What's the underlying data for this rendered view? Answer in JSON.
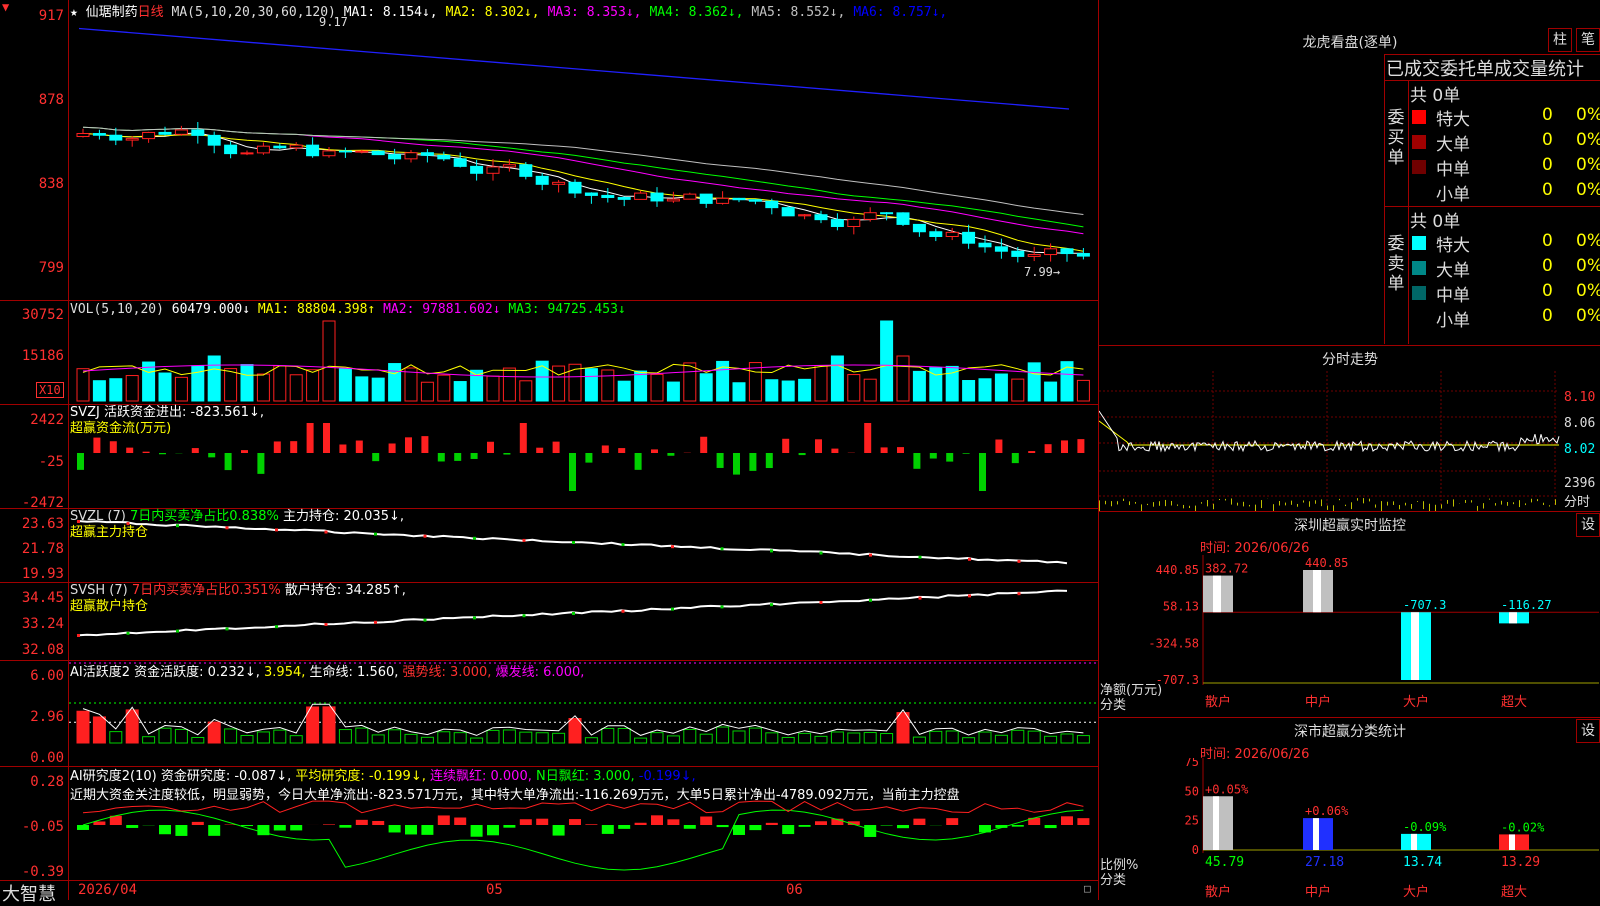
{
  "kline": {
    "title_star": "★",
    "stock_name": "仙琚制药",
    "period": "日线",
    "ma_params": "MA(5,10,20,30,60,120)",
    "ma_values": [
      {
        "label": "MA1:",
        "value": "8.154↓",
        "color": "#ffffff"
      },
      {
        "label": "MA2:",
        "value": "8.302↓",
        "color": "#ffff00"
      },
      {
        "label": "MA3:",
        "value": "8.353↓",
        "color": "#ff00ff"
      },
      {
        "label": "MA4:",
        "value": "8.362↓",
        "color": "#00ff00"
      },
      {
        "label": "MA5:",
        "value": "8.552↓",
        "color": "#c0c0c0"
      },
      {
        "label": "MA6:",
        "value": "8.757↓",
        "color": "#0000ff"
      }
    ],
    "y_labels": [
      "917",
      "878",
      "838",
      "799"
    ],
    "high_marker": "9.17",
    "low_marker": "7.99",
    "x_labels": [
      "2026/04",
      "05",
      "06"
    ],
    "colors": {
      "up": "#ff2020",
      "down": "#00ffff"
    }
  },
  "vol": {
    "params": "VOL(5,10,20)",
    "value": "60479.000↓",
    "ma1": "MA1: 88804.398↑",
    "ma2": "MA2: 97881.602↓",
    "ma3": "MA3: 94725.453↓",
    "y_labels": [
      "30752",
      "15186"
    ],
    "unit_badge": "X10"
  },
  "svzj": {
    "line1": "SVZJ  活跃资金进出: -823.561↓,",
    "line2": "超赢资金流(万元)",
    "y_labels": [
      "2422",
      "-25",
      "-2472"
    ]
  },
  "svzl": {
    "params": "SVZL (7)",
    "ratio": "7日内买卖净占比0.838%",
    "hold": "主力持仓: 20.035↓,",
    "line2": "超赢主力持仓",
    "y_labels": [
      "23.63",
      "21.78",
      "19.93"
    ]
  },
  "svsh": {
    "params": "SVSH (7)",
    "ratio": "7日内买卖净占比0.351%",
    "hold": "散户持仓: 34.285↑,",
    "line2": "超赢散户持仓",
    "y_labels": [
      "34.45",
      "33.24",
      "32.08"
    ]
  },
  "ai_active": {
    "p1": "AI活跃度2 资金活跃度: 0.232↓,",
    "p2": "3.954,",
    "p3": "生命线: 1.560,",
    "p4": "强势线: 3.000,",
    "p5": "爆发线: 6.000,",
    "y_labels": [
      "6.00",
      "2.96",
      "0.00"
    ]
  },
  "ai_research": {
    "p1": "AI研究度2(10) 资金研究度: -0.087↓,",
    "p2": "平均研究度: -0.199↓,",
    "p3": "连续飘红: 0.000,",
    "p4": "N日飘红: 3.000,",
    "p5": "-0.199↓,",
    "comment": "近期大资金关注度较低，明显弱势，今日大单净流出:-823.571万元，其中特大单净流出:-116.269万元，大单5日累计净出-4789.092万元，当前主力控盘",
    "y_labels": [
      "0.28",
      "-0.05",
      "-0.39"
    ]
  },
  "footer": {
    "logo": "大智慧"
  },
  "longhu": {
    "title": "龙虎看盘(逐单)",
    "btn1": "柱",
    "btn2": "笔",
    "header": "已成交委托单成交量统计",
    "buy_label": "委买单",
    "sell_label": "委卖单",
    "buy_total": "共 0单",
    "sell_total": "共 0单",
    "buy_rows": [
      {
        "name": "特大",
        "count": "0",
        "pct": "0%",
        "color": "#ff0000"
      },
      {
        "name": "大单",
        "count": "0",
        "pct": "0%",
        "color": "#a00000"
      },
      {
        "name": "中单",
        "count": "0",
        "pct": "0%",
        "color": "#700000"
      },
      {
        "name": "小单",
        "count": "0",
        "pct": "0%",
        "color": "#000000"
      }
    ],
    "sell_rows": [
      {
        "name": "特大",
        "count": "0",
        "pct": "0%",
        "color": "#00ffff"
      },
      {
        "name": "大单",
        "count": "0",
        "pct": "0%",
        "color": "#008888"
      },
      {
        "name": "中单",
        "count": "0",
        "pct": "0%",
        "color": "#006666"
      },
      {
        "name": "小单",
        "count": "0",
        "pct": "0%",
        "color": "#000000"
      }
    ]
  },
  "intraday": {
    "title": "分时走势",
    "y_labels": [
      "8.10",
      "8.06",
      "8.02"
    ],
    "vol_label": "2396",
    "vol_unit": "分时"
  },
  "monitor": {
    "title": "深圳超赢实时监控",
    "set": "设",
    "time": "时间: 2026/06/26",
    "y_labels": [
      "440.85",
      "58.13",
      "-324.58",
      "-707.3"
    ],
    "axis_title": "净额(万元)",
    "axis_cat": "分类",
    "categories": [
      "散户",
      "中户",
      "大户",
      "超大"
    ],
    "values": [
      382.72,
      440.85,
      -707.3,
      -116.27
    ],
    "value_labels": [
      "382.72",
      "440.85",
      "-707.3",
      "-116.27"
    ]
  },
  "classify": {
    "title": "深市超赢分类统计",
    "set": "设",
    "time": "时间: 2026/06/26",
    "y_labels": [
      "75",
      "50",
      "25",
      "0"
    ],
    "axis_title": "比例%",
    "axis_cat": "分类",
    "categories": [
      "散户",
      "中户",
      "大户",
      "超大"
    ],
    "values": [
      45.79,
      27.18,
      13.74,
      13.29
    ],
    "changes": [
      "+0.05%",
      "+0.06%",
      "-0.09%",
      "-0.02%"
    ]
  }
}
